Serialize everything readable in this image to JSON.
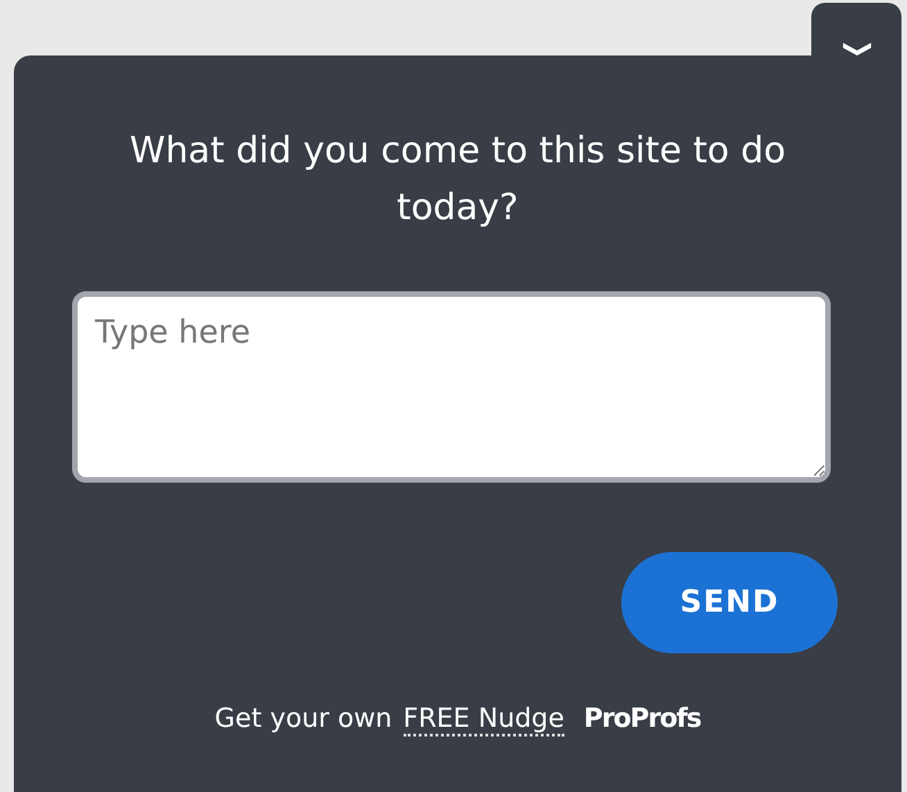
{
  "question": "What did you come to this site to do today?",
  "answer": {
    "placeholder": "Type here"
  },
  "send_button": "SEND",
  "footer": {
    "text": "Get your own",
    "link": "FREE Nudge",
    "brand": "ProProfs"
  }
}
